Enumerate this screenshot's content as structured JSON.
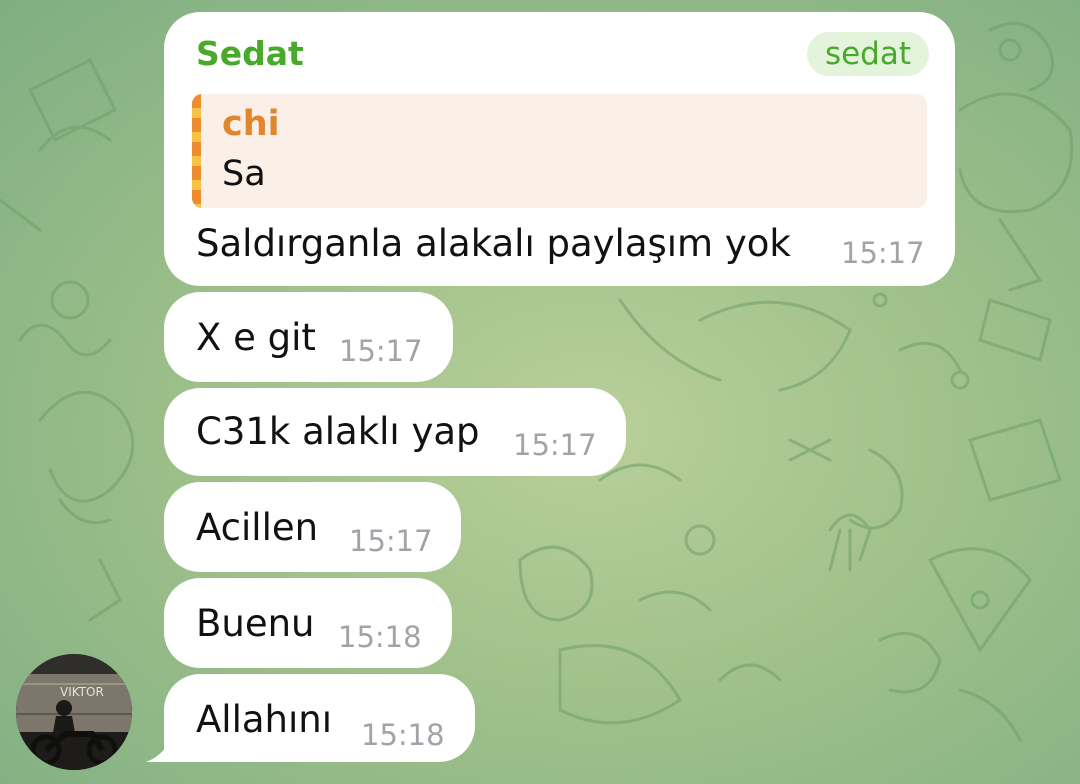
{
  "first_message": {
    "sender": "Sedat",
    "sender_tag": "sedat",
    "reply": {
      "author": "chi",
      "text": "Sa"
    },
    "text": "Saldırganla alakalı paylaşım yok",
    "time": "15:17"
  },
  "messages": [
    {
      "text": "X e git",
      "time": "15:17"
    },
    {
      "text": "C31k alaklı yap",
      "time": "15:17"
    },
    {
      "text": "Acillen",
      "time": "15:17"
    },
    {
      "text": "Buenu",
      "time": "15:18"
    },
    {
      "text": "Allahını",
      "time": "15:18"
    }
  ],
  "avatar": {
    "sign_text": "VIKTOR"
  },
  "colors": {
    "sender_name": "#48a92b",
    "reply_author": "#e1852e",
    "timestamp": "#a0a4a8",
    "bubble": "#ffffff"
  }
}
